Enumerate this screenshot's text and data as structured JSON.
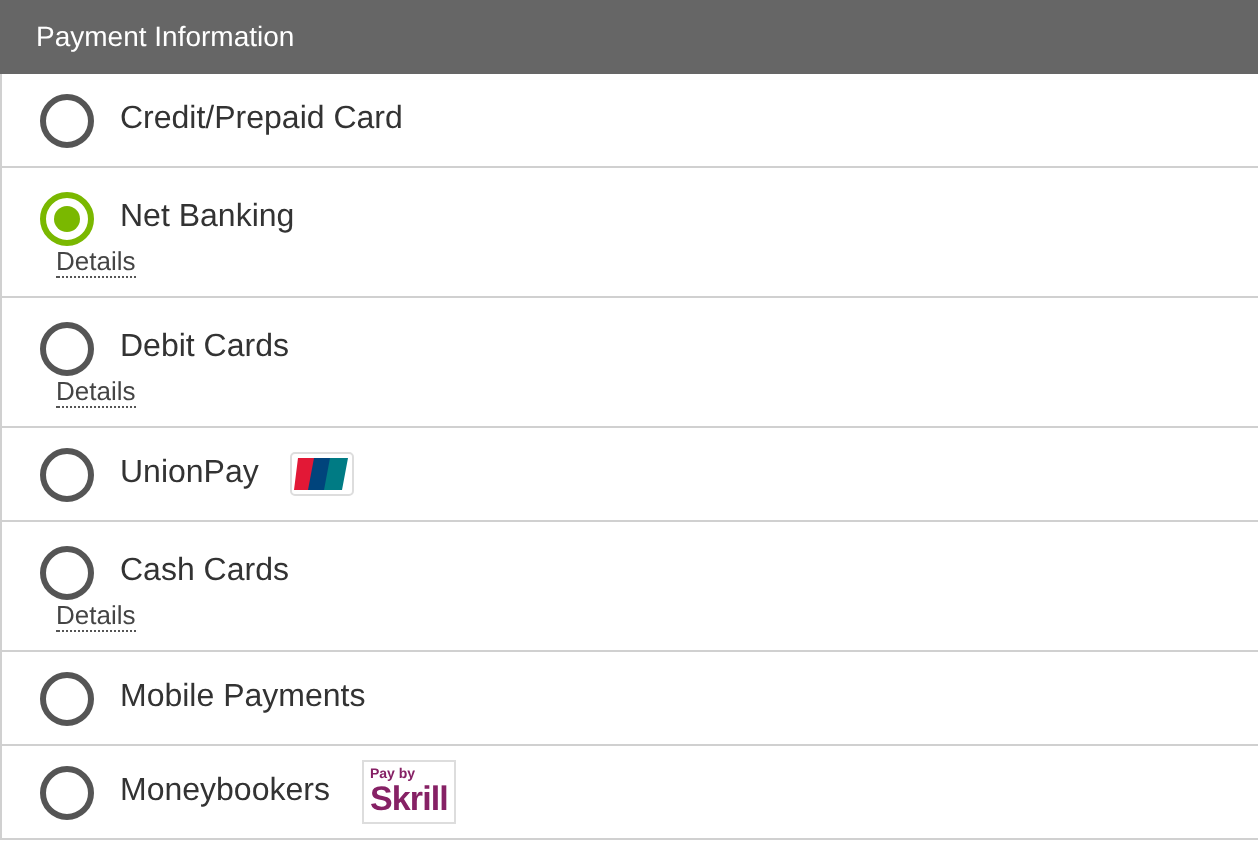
{
  "header": {
    "title": "Payment Information"
  },
  "methods": [
    {
      "label": "Credit/Prepaid Card",
      "selected": false
    },
    {
      "label": "Net Banking",
      "selected": true,
      "details": "Details"
    },
    {
      "label": "Debit Cards",
      "selected": false,
      "details": "Details"
    },
    {
      "label": "UnionPay",
      "selected": false,
      "logo": {
        "kind": "unionpay"
      }
    },
    {
      "label": "Cash Cards",
      "selected": false,
      "details": "Details"
    },
    {
      "label": "Mobile Payments",
      "selected": false
    },
    {
      "label": "Moneybookers",
      "selected": false,
      "logo": {
        "kind": "skrill",
        "small": "Pay by",
        "big": "Skrill"
      }
    }
  ]
}
